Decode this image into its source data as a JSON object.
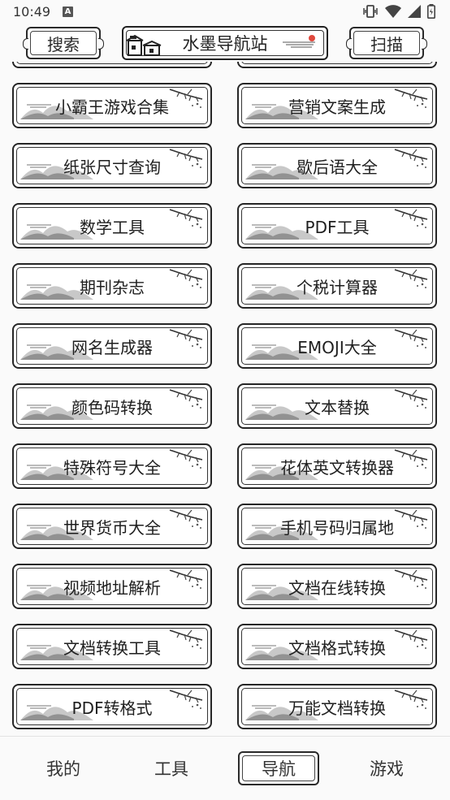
{
  "status_bar": {
    "time": "10:49",
    "badge": "A"
  },
  "header": {
    "search_label": "搜索",
    "title": "水墨导航站",
    "scan_label": "扫描"
  },
  "tools": [
    {
      "label": "小霸王游戏合集"
    },
    {
      "label": "营销文案生成"
    },
    {
      "label": "纸张尺寸查询"
    },
    {
      "label": "歇后语大全"
    },
    {
      "label": "数学工具"
    },
    {
      "label": "PDF工具"
    },
    {
      "label": "期刊杂志"
    },
    {
      "label": "个税计算器"
    },
    {
      "label": "网名生成器"
    },
    {
      "label": "EMOJI大全"
    },
    {
      "label": "颜色码转换"
    },
    {
      "label": "文本替换"
    },
    {
      "label": "特殊符号大全"
    },
    {
      "label": "花体英文转换器"
    },
    {
      "label": "世界货币大全"
    },
    {
      "label": "手机号码归属地"
    },
    {
      "label": "视频地址解析"
    },
    {
      "label": "文档在线转换"
    },
    {
      "label": "文档转换工具"
    },
    {
      "label": "文档格式转换"
    },
    {
      "label": "PDF转格式"
    },
    {
      "label": "万能文档转换"
    }
  ],
  "bottom_nav": [
    {
      "label": "我的"
    },
    {
      "label": "工具"
    },
    {
      "label": "导航"
    },
    {
      "label": "游戏"
    }
  ],
  "active_nav": "导航",
  "colors": {
    "ink": "#262626",
    "accent_red": "#e0483d"
  }
}
